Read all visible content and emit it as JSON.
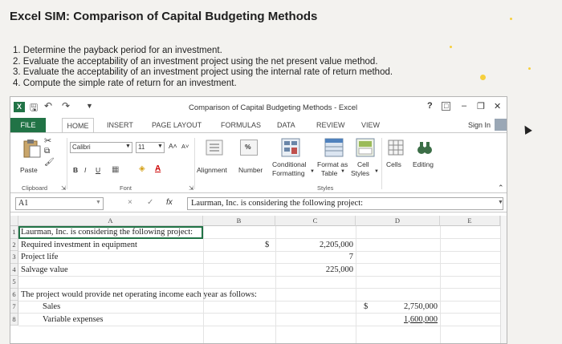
{
  "page": {
    "title": "Excel SIM: Comparison of Capital Budgeting Methods",
    "instructions": [
      "1. Determine the payback period for an investment.",
      "2. Evaluate the acceptability of an investment project using the net present value method.",
      "3. Evaluate the acceptability of an investment project using the internal rate of return method.",
      "4. Compute the simple rate of return for an investment."
    ]
  },
  "excel": {
    "window_title": "Comparison of Capital Budgeting Methods - Excel",
    "logo_text": "X",
    "help": "?",
    "tabs": {
      "file": "FILE",
      "home": "HOME",
      "insert": "INSERT",
      "page_layout": "PAGE LAYOUT",
      "formulas": "FORMULAS",
      "data": "DATA",
      "review": "REVIEW",
      "view": "VIEW"
    },
    "sign_in": "Sign In",
    "ribbon": {
      "paste": "Paste",
      "clipboard": "Clipboard",
      "font_name": "Calibri",
      "font_size": "11",
      "font_group": "Font",
      "bold": "B",
      "italic": "I",
      "underline": "U",
      "grow_font": "A˄",
      "shrink_font": "A˅",
      "alignment": "Alignment",
      "number": "Number",
      "percent": "%",
      "conditional_formatting_1": "Conditional",
      "conditional_formatting_2": "Formatting",
      "format_as_table_1": "Format as",
      "format_as_table_2": "Table",
      "cell_styles_1": "Cell",
      "cell_styles_2": "Styles",
      "styles_group": "Styles",
      "cells": "Cells",
      "editing": "Editing"
    },
    "formula_bar": {
      "name_box": "A1",
      "cancel": "×",
      "enter": "✓",
      "fx": "fx",
      "content": "Laurman, Inc. is considering the following project:"
    },
    "columns": [
      "A",
      "B",
      "C",
      "D",
      "E"
    ],
    "rows": [
      "1",
      "2",
      "3",
      "4",
      "5",
      "6",
      "7",
      "8"
    ],
    "cells": {
      "r1_a": "Laurman, Inc. is considering the following project:",
      "r2_a": "Required investment in equipment",
      "r2_dollar": "$",
      "r2_c": "2,205,000",
      "r3_a": "Project life",
      "r3_c": "7",
      "r4_a": "Salvage value",
      "r4_c": "225,000",
      "r6_a": "The project would provide net operating income each year as follows:",
      "r7_a": "Sales",
      "r7_dollar": "$",
      "r7_d": "2,750,000",
      "r8_a": "Variable expenses",
      "r8_d": "1,600,000"
    }
  }
}
